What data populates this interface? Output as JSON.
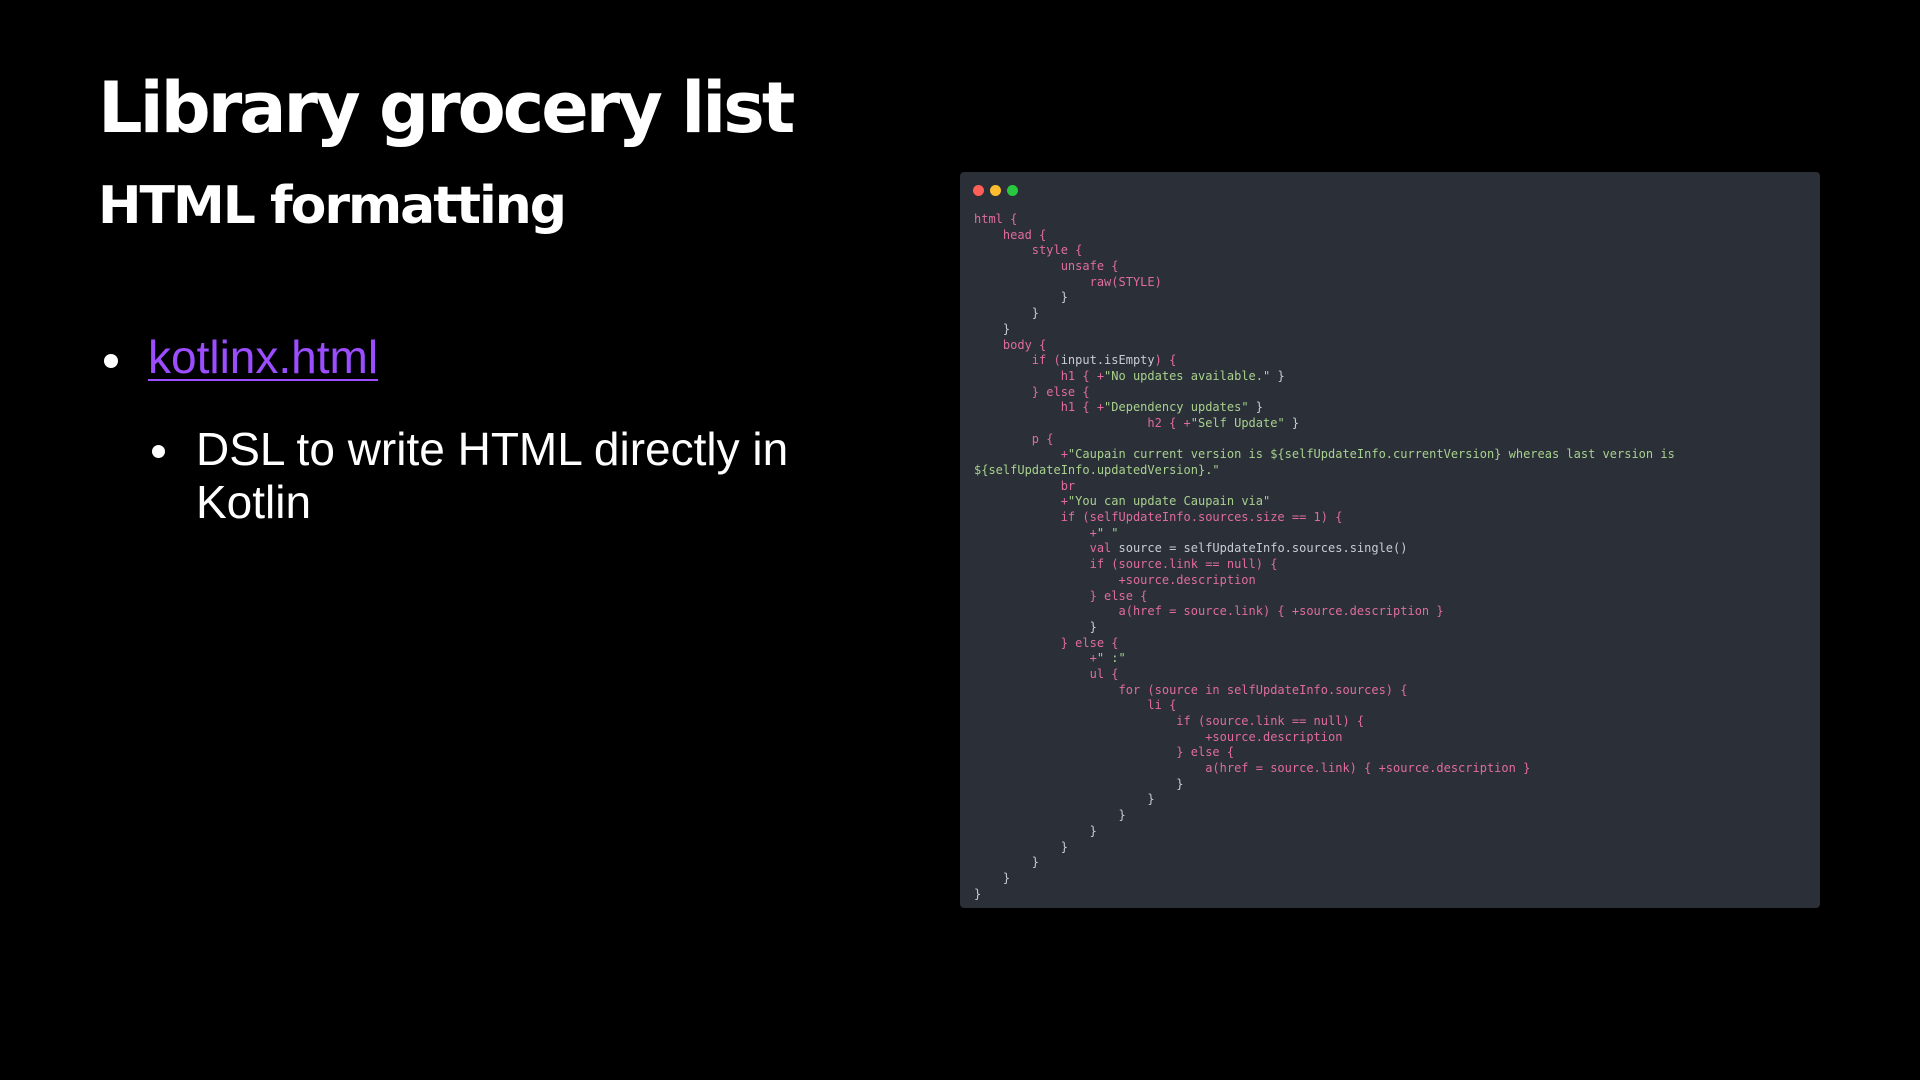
{
  "slide": {
    "title": "Library grocery list",
    "subtitle": "HTML formatting",
    "bullets": [
      {
        "text": "kotlinx.html",
        "is_link": true,
        "sub_bullets": [
          {
            "text": "DSL to write HTML directly in Kotlin"
          }
        ]
      }
    ]
  },
  "code_window": {
    "traffic_lights": [
      "#ff5f57",
      "#febc2e",
      "#28c840"
    ],
    "lines": [
      [
        {
          "t": "html {",
          "c": "kw"
        }
      ],
      [
        {
          "t": "    head {",
          "c": "kw"
        }
      ],
      [
        {
          "t": "        style {",
          "c": "kw"
        }
      ],
      [
        {
          "t": "            unsafe {",
          "c": "kw"
        }
      ],
      [
        {
          "t": "                raw(STYLE)",
          "c": "kw"
        }
      ],
      [
        {
          "t": "            }",
          "c": "plain"
        }
      ],
      [
        {
          "t": "        }",
          "c": "plain"
        }
      ],
      [
        {
          "t": "    }",
          "c": "plain"
        }
      ],
      [
        {
          "t": "    body {",
          "c": "kw"
        }
      ],
      [
        {
          "t": "        if (",
          "c": "kw"
        },
        {
          "t": "input.isEmpty",
          "c": "plain"
        },
        {
          "t": ") {",
          "c": "kw"
        }
      ],
      [
        {
          "t": "            h1 { +",
          "c": "kw"
        },
        {
          "t": "\"No updates available.\"",
          "c": "str"
        },
        {
          "t": " }",
          "c": "plain"
        }
      ],
      [
        {
          "t": "        } else {",
          "c": "kw"
        }
      ],
      [
        {
          "t": "            h1 { +",
          "c": "kw"
        },
        {
          "t": "\"Dependency updates\"",
          "c": "str"
        },
        {
          "t": " }",
          "c": "plain"
        }
      ],
      [
        {
          "t": "                        h2 { +",
          "c": "kw"
        },
        {
          "t": "\"Self Update\"",
          "c": "str"
        },
        {
          "t": " }",
          "c": "plain"
        }
      ],
      [
        {
          "t": "        p {",
          "c": "kw"
        }
      ],
      [
        {
          "t": "            +",
          "c": "kw"
        },
        {
          "t": "\"Caupain current version is ${selfUpdateInfo.currentVersion} whereas last version is",
          "c": "str"
        }
      ],
      [
        {
          "t": "${selfUpdateInfo.updatedVersion}.\"",
          "c": "str"
        }
      ],
      [
        {
          "t": "            br",
          "c": "kw"
        }
      ],
      [
        {
          "t": "            +",
          "c": "kw"
        },
        {
          "t": "\"You can update Caupain via\"",
          "c": "str"
        }
      ],
      [
        {
          "t": "            if (selfUpdateInfo.sources.size == 1) {",
          "c": "kw"
        }
      ],
      [
        {
          "t": "                +",
          "c": "kw"
        },
        {
          "t": "\" \"",
          "c": "str"
        }
      ],
      [
        {
          "t": "                val ",
          "c": "kw"
        },
        {
          "t": "source = selfUpdateInfo.sources.single()",
          "c": "plain"
        }
      ],
      [
        {
          "t": "                if (source.link == null) {",
          "c": "kw"
        }
      ],
      [
        {
          "t": "                    +source.description",
          "c": "kw"
        }
      ],
      [
        {
          "t": "                } else {",
          "c": "kw"
        }
      ],
      [
        {
          "t": "                    a(href = source.link) { +source.description }",
          "c": "kw"
        }
      ],
      [
        {
          "t": "                }",
          "c": "plain"
        }
      ],
      [
        {
          "t": "            } else {",
          "c": "kw"
        }
      ],
      [
        {
          "t": "                +",
          "c": "kw"
        },
        {
          "t": "\" :\"",
          "c": "str"
        }
      ],
      [
        {
          "t": "                ul {",
          "c": "kw"
        }
      ],
      [
        {
          "t": "                    for (source in selfUpdateInfo.sources) {",
          "c": "kw"
        }
      ],
      [
        {
          "t": "                        li {",
          "c": "kw"
        }
      ],
      [
        {
          "t": "                            if (source.link == null) {",
          "c": "kw"
        }
      ],
      [
        {
          "t": "                                +source.description",
          "c": "kw"
        }
      ],
      [
        {
          "t": "                            } else {",
          "c": "kw"
        }
      ],
      [
        {
          "t": "                                a(href = source.link) { +source.description }",
          "c": "kw"
        }
      ],
      [
        {
          "t": "                            }",
          "c": "plain"
        }
      ],
      [
        {
          "t": "                        }",
          "c": "plain"
        }
      ],
      [
        {
          "t": "                    }",
          "c": "plain"
        }
      ],
      [
        {
          "t": "                }",
          "c": "plain"
        }
      ],
      [
        {
          "t": "            }",
          "c": "plain"
        }
      ],
      [
        {
          "t": "        }",
          "c": "plain"
        }
      ],
      [
        {
          "t": "    }",
          "c": "plain"
        }
      ],
      [
        {
          "t": "}",
          "c": "plain"
        }
      ]
    ]
  }
}
